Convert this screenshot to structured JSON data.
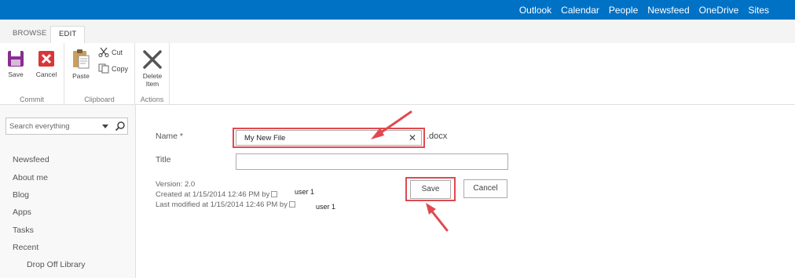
{
  "suitebar": {
    "links": [
      "Outlook",
      "Calendar",
      "People",
      "Newsfeed",
      "OneDrive",
      "Sites"
    ]
  },
  "ribbon": {
    "tabs": [
      "BROWSE",
      "EDIT"
    ],
    "commit": {
      "label": "Commit",
      "save": "Save",
      "cancel": "Cancel"
    },
    "clipboard": {
      "label": "Clipboard",
      "paste": "Paste",
      "cut": "Cut",
      "copy": "Copy"
    },
    "actions": {
      "label": "Actions",
      "delete_line1": "Delete",
      "delete_line2": "Item"
    }
  },
  "leftnav": {
    "search_placeholder": "Search everything",
    "items": [
      "Newsfeed",
      "About me",
      "Blog",
      "Apps",
      "Tasks",
      "Recent"
    ],
    "sub_items": [
      "Drop Off Library"
    ]
  },
  "form": {
    "name_label": "Name *",
    "name_value": "My New File",
    "extension": ".docx",
    "title_label": "Title",
    "title_value": "",
    "version": "Version: 2.0",
    "created": "Created at 1/15/2014 12:46 PM  by",
    "created_user": "user 1",
    "modified": "Last modified at 1/15/2014 12:46 PM  by",
    "modified_user": "user 1",
    "save_label": "Save",
    "cancel_label": "Cancel"
  },
  "colors": {
    "suitebar": "#0072c6",
    "highlight": "#e0494f"
  }
}
